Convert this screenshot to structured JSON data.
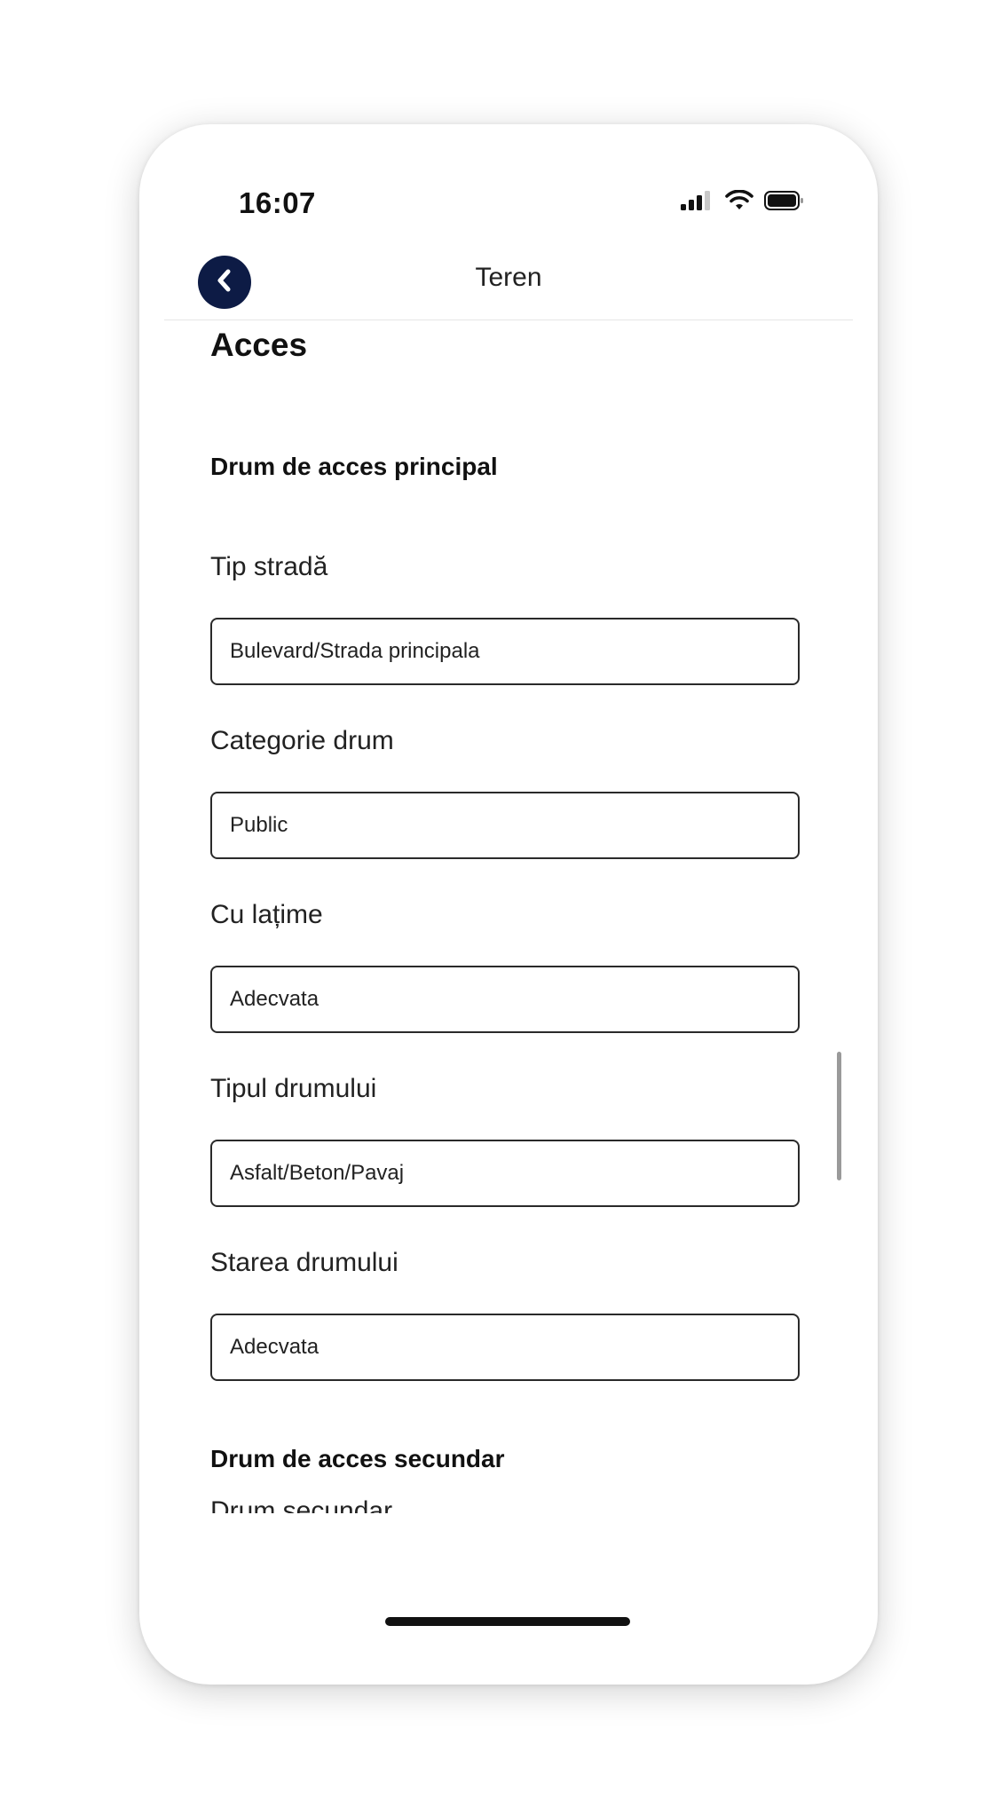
{
  "status_bar": {
    "time": "16:07",
    "icons": [
      "signal-icon",
      "wifi-icon",
      "battery-icon"
    ]
  },
  "nav": {
    "title": "Teren",
    "back_icon": "chevron-left-icon",
    "back_color": "#0d1b45"
  },
  "section": {
    "title": "Acces"
  },
  "primary_access": {
    "heading": "Drum de acces principal",
    "fields": [
      {
        "label": "Tip stradă",
        "value": "Bulevard/Strada principala"
      },
      {
        "label": "Categorie drum",
        "value": "Public"
      },
      {
        "label": "Cu lațime",
        "value": "Adecvata"
      },
      {
        "label": "Tipul drumului",
        "value": "Asfalt/Beton/Pavaj"
      },
      {
        "label": "Starea drumului",
        "value": "Adecvata"
      }
    ]
  },
  "secondary_access": {
    "heading": "Drum de acces secundar",
    "fields": [
      {
        "label": "Drum secundar"
      }
    ]
  }
}
